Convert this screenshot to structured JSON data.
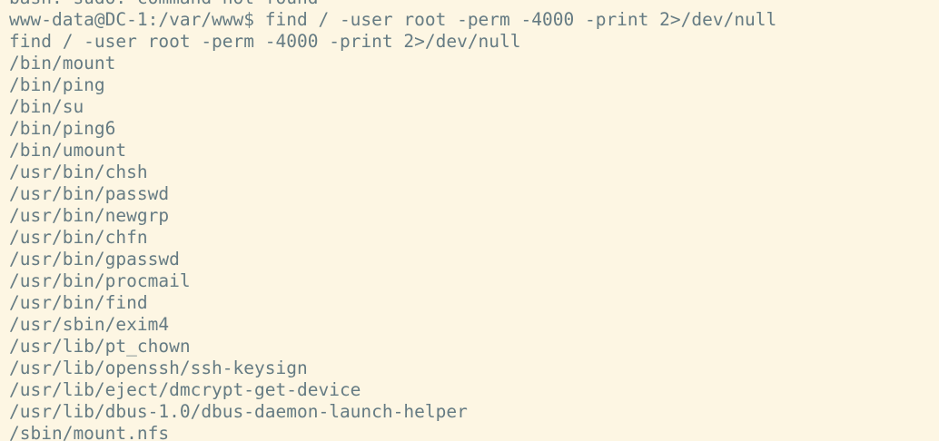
{
  "terminal": {
    "background": "#fdf6e3",
    "foreground": "#657b83",
    "lines": [
      "bash: sudo: command not found",
      "www-data@DC-1:/var/www$ find / -user root -perm -4000 -print 2>/dev/null",
      "find / -user root -perm -4000 -print 2>/dev/null",
      "/bin/mount",
      "/bin/ping",
      "/bin/su",
      "/bin/ping6",
      "/bin/umount",
      "/usr/bin/chsh",
      "/usr/bin/passwd",
      "/usr/bin/newgrp",
      "/usr/bin/chfn",
      "/usr/bin/gpasswd",
      "/usr/bin/procmail",
      "/usr/bin/find",
      "/usr/sbin/exim4",
      "/usr/lib/pt_chown",
      "/usr/lib/openssh/ssh-keysign",
      "/usr/lib/eject/dmcrypt-get-device",
      "/usr/lib/dbus-1.0/dbus-daemon-launch-helper",
      "/sbin/mount.nfs"
    ]
  }
}
